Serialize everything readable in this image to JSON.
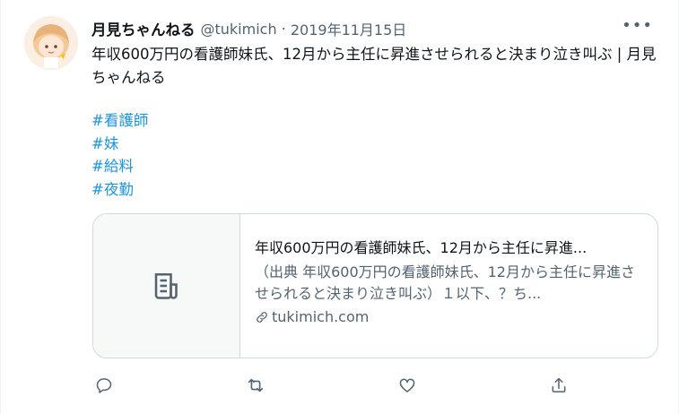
{
  "author": {
    "name": "月見ちゃんねる",
    "handle": "@tukimich",
    "separator": "·",
    "date": "2019年11月15日"
  },
  "tweet": {
    "text": "年収600万円の看護師妹氏、12月から主任に昇進させられると決まり泣き叫ぶ | 月見ちゃんねる",
    "hashtags": [
      "#看護師",
      "#妹",
      "#給料",
      "#夜勤"
    ]
  },
  "card": {
    "title": "年収600万円の看護師妹氏、12月から主任に昇進...",
    "description": "（出典 年収600万円の看護師妹氏、12月から主任に昇進させられると決まり泣き叫ぶ）１以下、？ち...",
    "domain": "tukimich.com",
    "thumb_icon": "article-icon"
  },
  "more_label": "•••",
  "icons": {
    "reply": "reply-icon",
    "retweet": "retweet-icon",
    "like": "like-icon",
    "share": "share-icon",
    "link": "link-icon"
  },
  "colors": {
    "hashtag": "#1b95e0",
    "secondary_text": "#536471",
    "border": "#cfd9de"
  }
}
